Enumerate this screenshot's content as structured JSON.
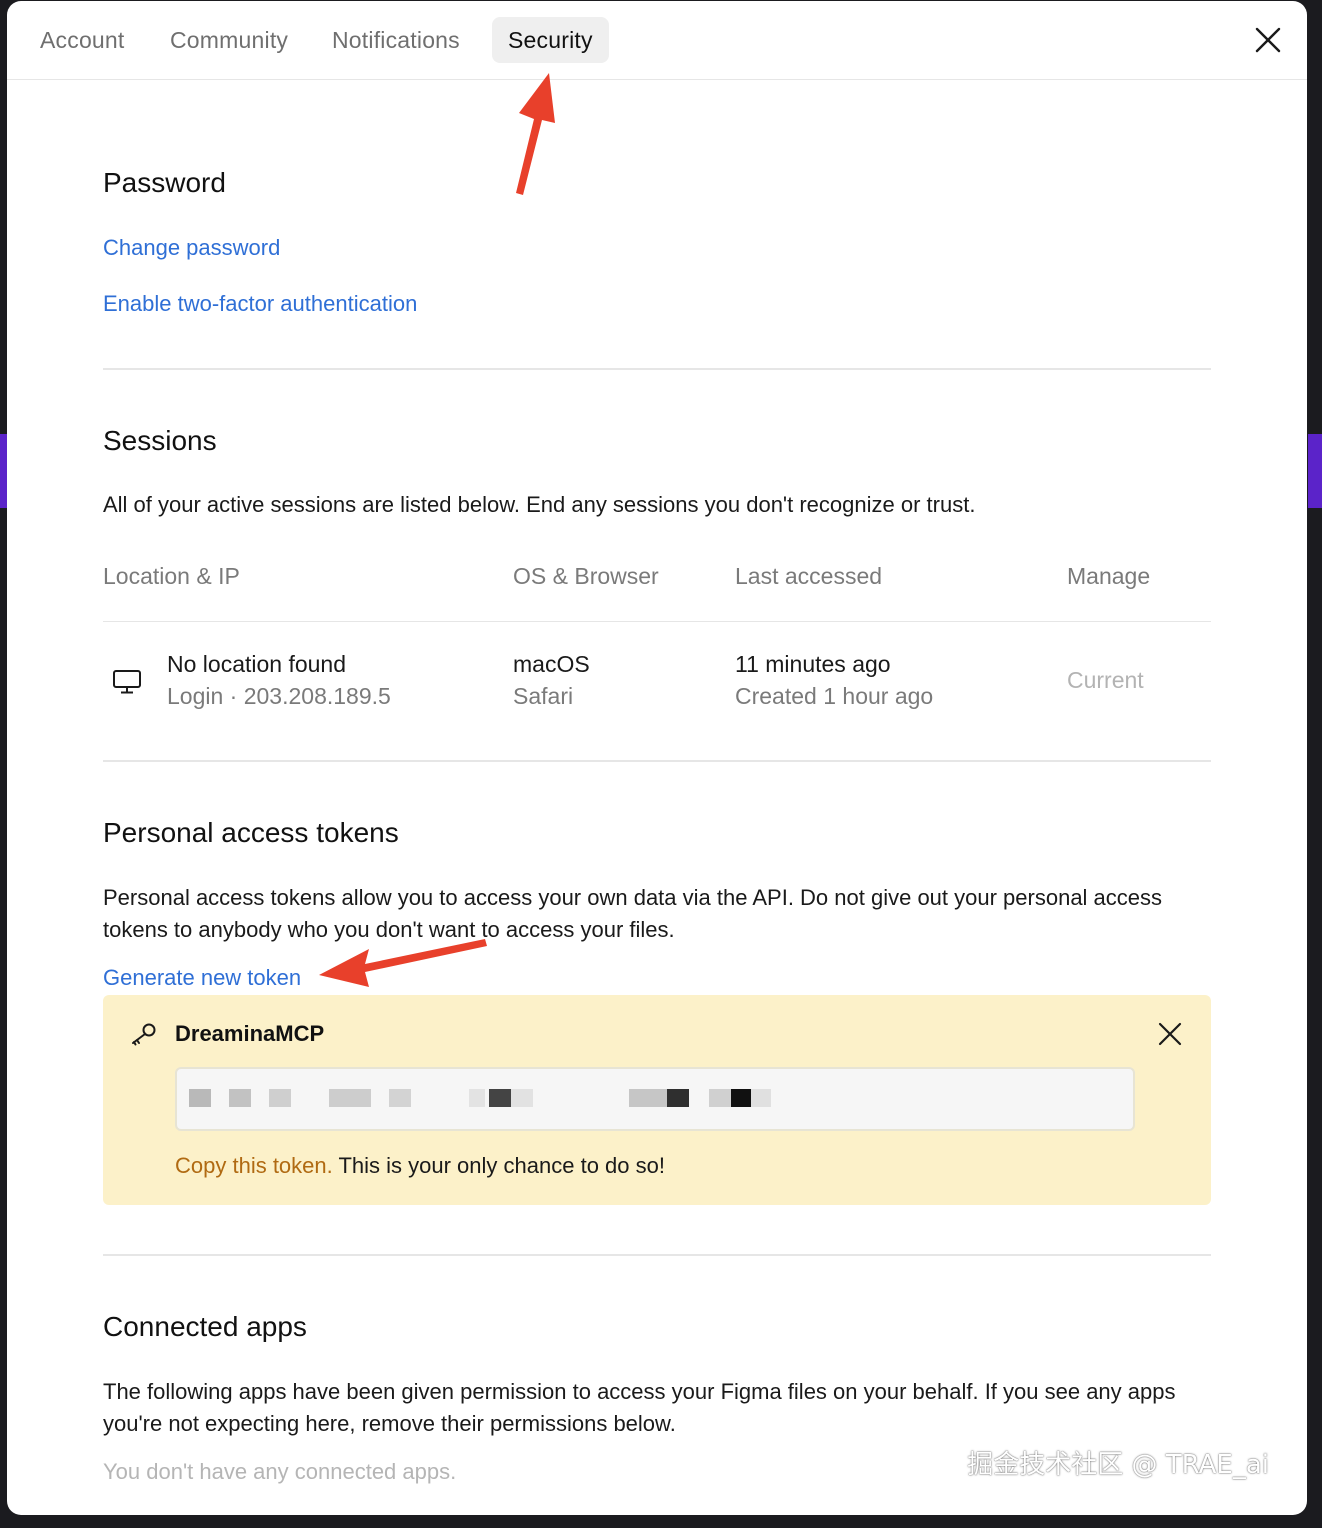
{
  "tabs": [
    {
      "label": "Account",
      "active": false
    },
    {
      "label": "Community",
      "active": false
    },
    {
      "label": "Notifications",
      "active": false
    },
    {
      "label": "Security",
      "active": true
    }
  ],
  "password": {
    "title": "Password",
    "change_link": "Change password",
    "two_factor_link": "Enable two-factor authentication"
  },
  "sessions": {
    "title": "Sessions",
    "description": "All of your active sessions are listed below. End any sessions you don't recognize or trust.",
    "columns": [
      "Location & IP",
      "OS & Browser",
      "Last accessed",
      "Manage"
    ],
    "rows": [
      {
        "location": "No location found",
        "ip": "Login · 203.208.189.5",
        "os": "macOS",
        "browser": "Safari",
        "last_accessed": "11 minutes ago",
        "created": "Created 1 hour ago",
        "manage": "Current"
      }
    ]
  },
  "tokens": {
    "title": "Personal access tokens",
    "description": "Personal access tokens allow you to access your own data via the API. Do not give out your personal access tokens to anybody who you don't want to access your files.",
    "generate_link": "Generate new token",
    "new_token": {
      "name": "DreaminaMCP",
      "copy_link": "Copy this token.",
      "warning": "This is your only chance to do so!"
    }
  },
  "connected_apps": {
    "title": "Connected apps",
    "description": "The following apps have been given permission to access your Figma files on your behalf. If you see any apps you're not expecting here, remove their permissions below.",
    "empty_text": "You don't have any connected apps."
  },
  "watermark": "掘金技术社区 @ TRAE_ai",
  "colors": {
    "link": "#2f6fd6",
    "token_card_bg": "#fcf1c9",
    "copy_link": "#b06a12",
    "annotation_arrow": "#e8402b"
  },
  "icons": {
    "close": "close-icon",
    "device": "monitor-icon",
    "token": "key-icon"
  }
}
